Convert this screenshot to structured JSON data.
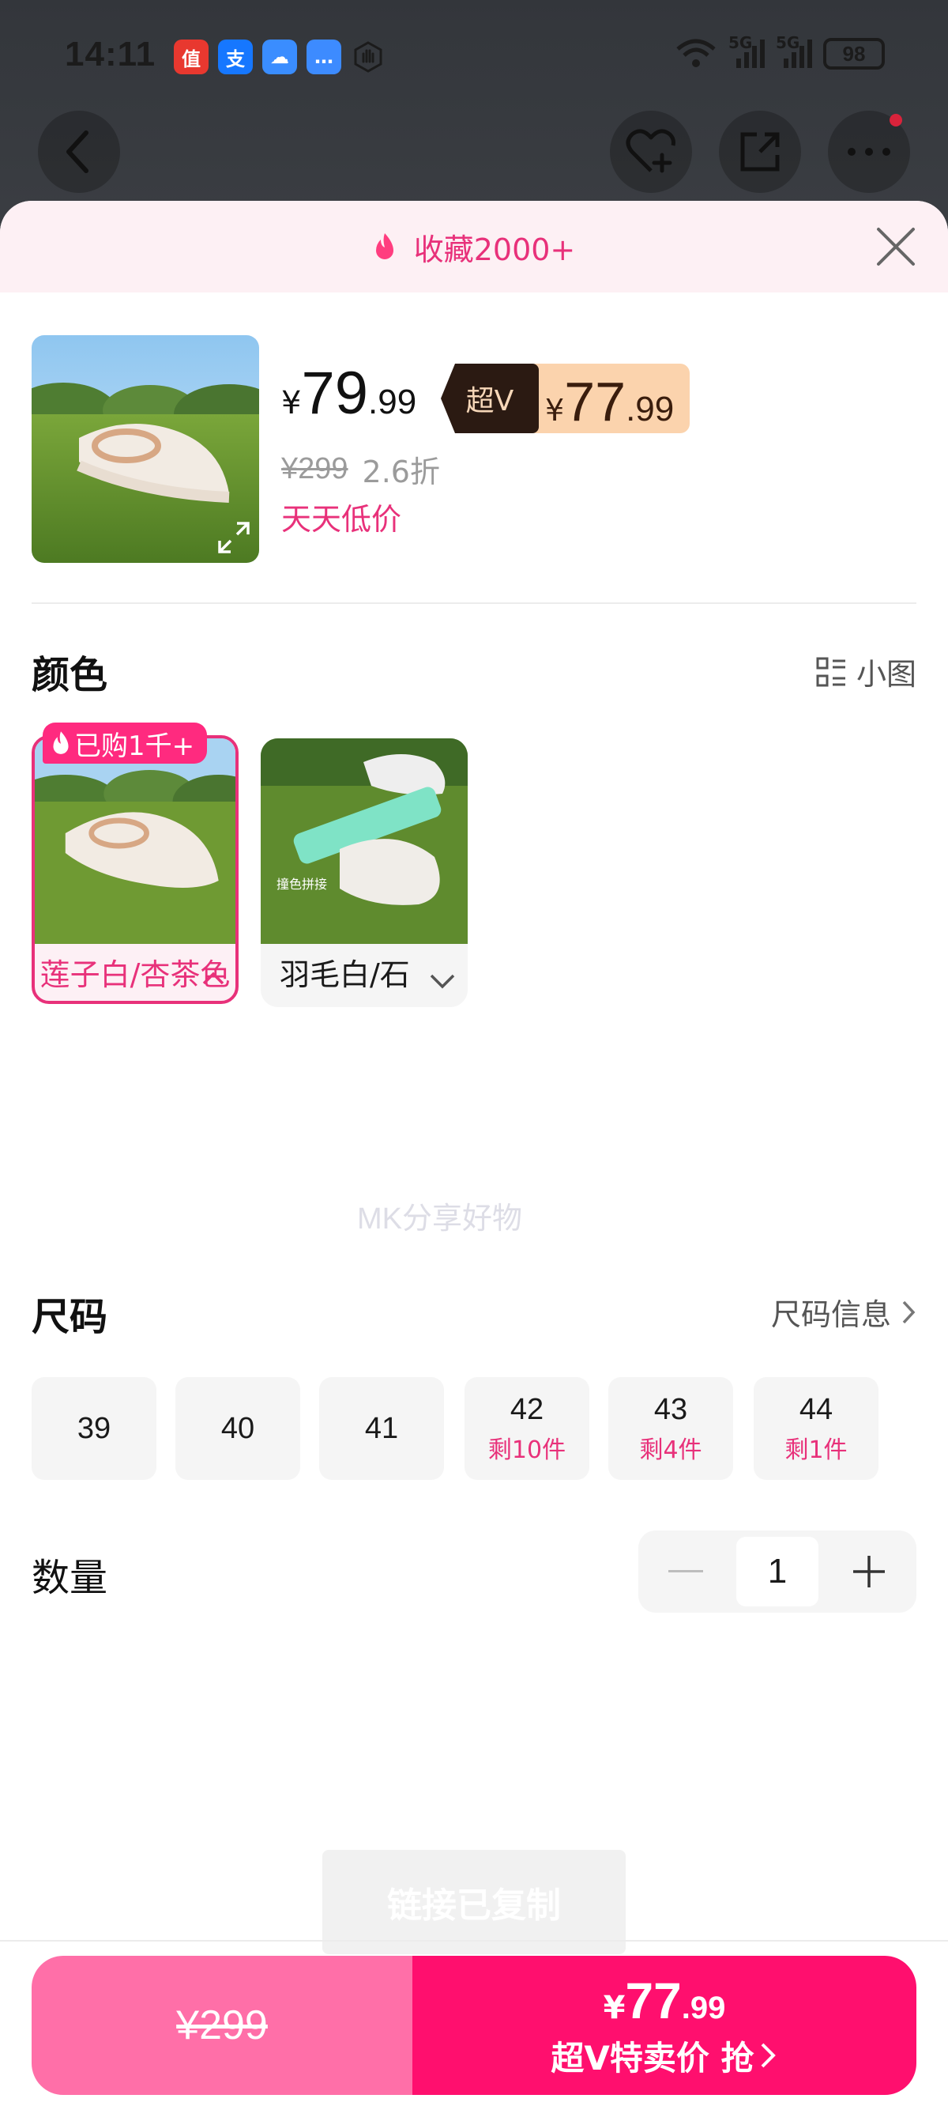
{
  "status_bar": {
    "time": "14:11",
    "apps": [
      {
        "name": "zhide-app-icon",
        "glyph": "值",
        "color": "#e8382f"
      },
      {
        "name": "alipay-app-icon",
        "glyph": "支",
        "color": "#1677ff"
      },
      {
        "name": "cloud-app-icon",
        "glyph": "☁",
        "color": "#3a8dff"
      },
      {
        "name": "message-app-icon",
        "glyph": "…",
        "color": "#3d8bff"
      }
    ],
    "network_1": "5G",
    "network_2": "5G",
    "battery": "98"
  },
  "sheet": {
    "header_title": "收藏2000+",
    "product": {
      "price_yen": "¥",
      "price_int": "79",
      "price_dec": ".99",
      "superv_label": "超V",
      "superv_price_yen": "¥",
      "superv_price_int": "77",
      "superv_price_dec": ".99",
      "original_price": "¥299",
      "discount": "2.6折",
      "promo_text": "天天低价"
    },
    "color_section": {
      "title": "颜色",
      "view_toggle": "小图",
      "options": [
        {
          "label": "莲子白/杏茶色",
          "badge": "已购1千+",
          "selected": true
        },
        {
          "label": "羽毛白/石",
          "selected": false
        }
      ]
    },
    "watermark": "MK分享好物",
    "size_section": {
      "title": "尺码",
      "info_link": "尺码信息",
      "sizes": [
        {
          "size": "39",
          "stock": ""
        },
        {
          "size": "40",
          "stock": ""
        },
        {
          "size": "41",
          "stock": ""
        },
        {
          "size": "42",
          "stock": "剩10件"
        },
        {
          "size": "43",
          "stock": "剩4件"
        },
        {
          "size": "44",
          "stock": "剩1件"
        }
      ]
    },
    "quantity_section": {
      "title": "数量",
      "value": "1"
    },
    "toast": "链接已复制",
    "bottom_bar": {
      "normal_price": "¥299",
      "superv_price_yen": "¥",
      "superv_price_int": "77",
      "superv_price_dec": ".99",
      "superv_label": "超V特卖价 抢"
    }
  },
  "colors": {
    "accent_pink": "#e8317a",
    "buy_pink": "#ff0f6e",
    "normal_buy_pink": "#ff6fa8",
    "superv_dark": "#2b1a12",
    "superv_gold": "#fbd3ad"
  }
}
